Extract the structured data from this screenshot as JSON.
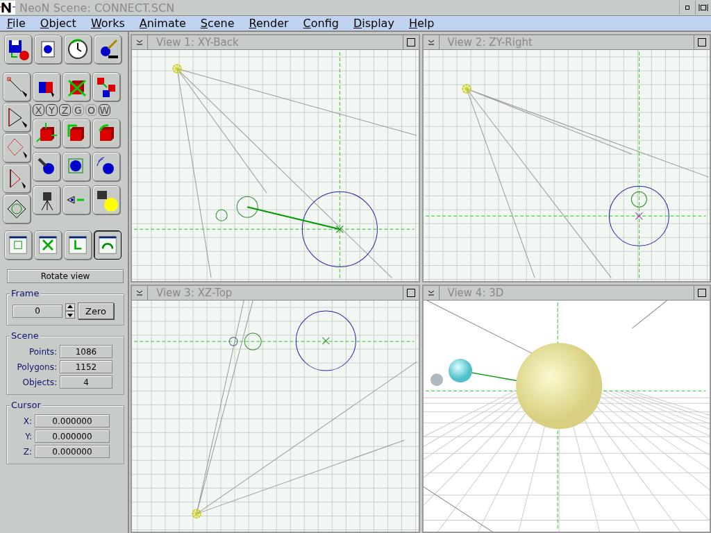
{
  "window": {
    "title": "NeoN Scene: CONNECT.SCN"
  },
  "menu": [
    "File",
    "Object",
    "Works",
    "Animate",
    "Scene",
    "Render",
    "Config",
    "Display",
    "Help"
  ],
  "axis_buttons": [
    {
      "label": "X",
      "selected": true
    },
    {
      "label": "Y",
      "selected": true
    },
    {
      "label": "Z",
      "selected": true
    },
    {
      "label": "G",
      "selected": false
    },
    {
      "label": "O",
      "selected": false
    },
    {
      "label": "W",
      "selected": true
    }
  ],
  "view_tools": [
    {
      "selected": false
    },
    {
      "selected": false
    },
    {
      "selected": false
    },
    {
      "selected": true
    }
  ],
  "mode_label": "Rotate view",
  "frame": {
    "title": "Frame",
    "value": "0",
    "button": "Zero"
  },
  "scene": {
    "title": "Scene",
    "stats": [
      {
        "label": "Points:",
        "value": "1086"
      },
      {
        "label": "Polygons:",
        "value": "1152"
      },
      {
        "label": "Objects:",
        "value": "4"
      }
    ]
  },
  "cursor": {
    "title": "Cursor",
    "coords": [
      {
        "label": "X:",
        "value": "0.000000"
      },
      {
        "label": "Y:",
        "value": "0.000000"
      },
      {
        "label": "Z:",
        "value": "0.000000"
      }
    ]
  },
  "views": [
    {
      "title": "View 1: XY-Back",
      "kind": "xy-back"
    },
    {
      "title": "View 2: ZY-Right",
      "kind": "zy-right"
    },
    {
      "title": "View 3: XZ-Top",
      "kind": "xz-top"
    },
    {
      "title": "View 4: 3D",
      "kind": "perspective"
    }
  ]
}
